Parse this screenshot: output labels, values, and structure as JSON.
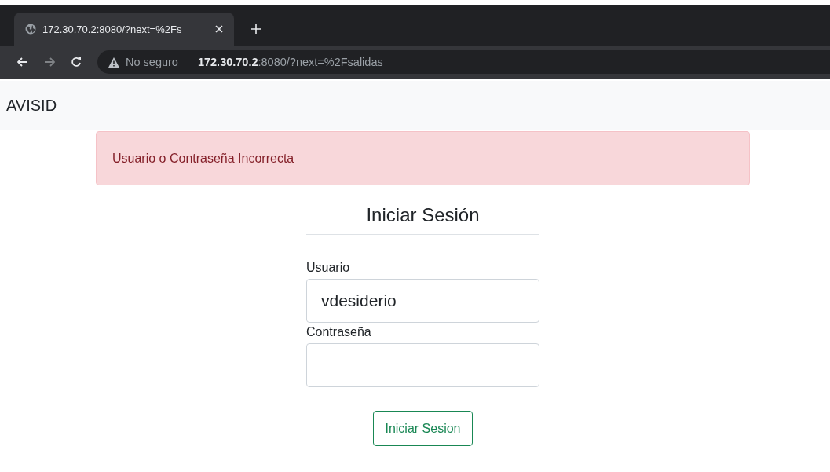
{
  "browser": {
    "tab": {
      "title": "172.30.70.2:8080/?next=%2Fs",
      "selected": true
    },
    "address": {
      "security": "No seguro",
      "host": "172.30.70.2",
      "path": ":8080/?next=%2Fsalidas"
    }
  },
  "navbar": {
    "brand": "AVISID"
  },
  "alert": {
    "message": "Usuario o Contraseña Incorrecta"
  },
  "form": {
    "title": "Iniciar Sesión",
    "fields": [
      {
        "label": "Usuario",
        "value": "vdesiderio"
      },
      {
        "label": "Contraseña"
      }
    ],
    "submit": "Iniciar Sesion"
  }
}
